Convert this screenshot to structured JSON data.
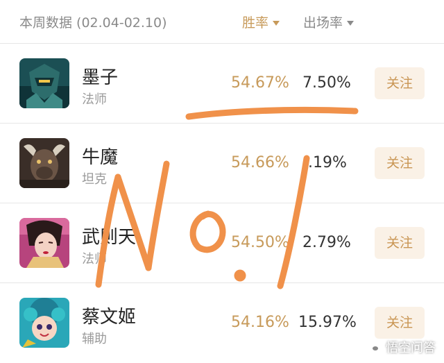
{
  "header": {
    "title": "本周数据 (02.04-02.10)",
    "sort_win_rate": "胜率",
    "sort_pick_rate": "出场率"
  },
  "heroes": [
    {
      "name": "墨子",
      "role": "法师",
      "win_rate": "54.67%",
      "pick_rate": "7.50%",
      "follow": "关注"
    },
    {
      "name": "牛魔",
      "role": "坦克",
      "win_rate": "54.66%",
      "pick_rate": ".19%",
      "follow": "关注"
    },
    {
      "name": "武则天",
      "role": "法师",
      "win_rate": "54.50%",
      "pick_rate": "2.79%",
      "follow": "关注"
    },
    {
      "name": "蔡文姬",
      "role": "辅助",
      "win_rate": "54.16%",
      "pick_rate": "15.97%",
      "follow": "关注"
    }
  ],
  "annotation": {
    "text": "No.1",
    "color": "#f0914a"
  },
  "watermark": {
    "text": "悟空问答"
  },
  "colors": {
    "accent_gold": "#c79a5a",
    "button_bg": "#faf1e6",
    "divider": "#e6e6e6"
  }
}
